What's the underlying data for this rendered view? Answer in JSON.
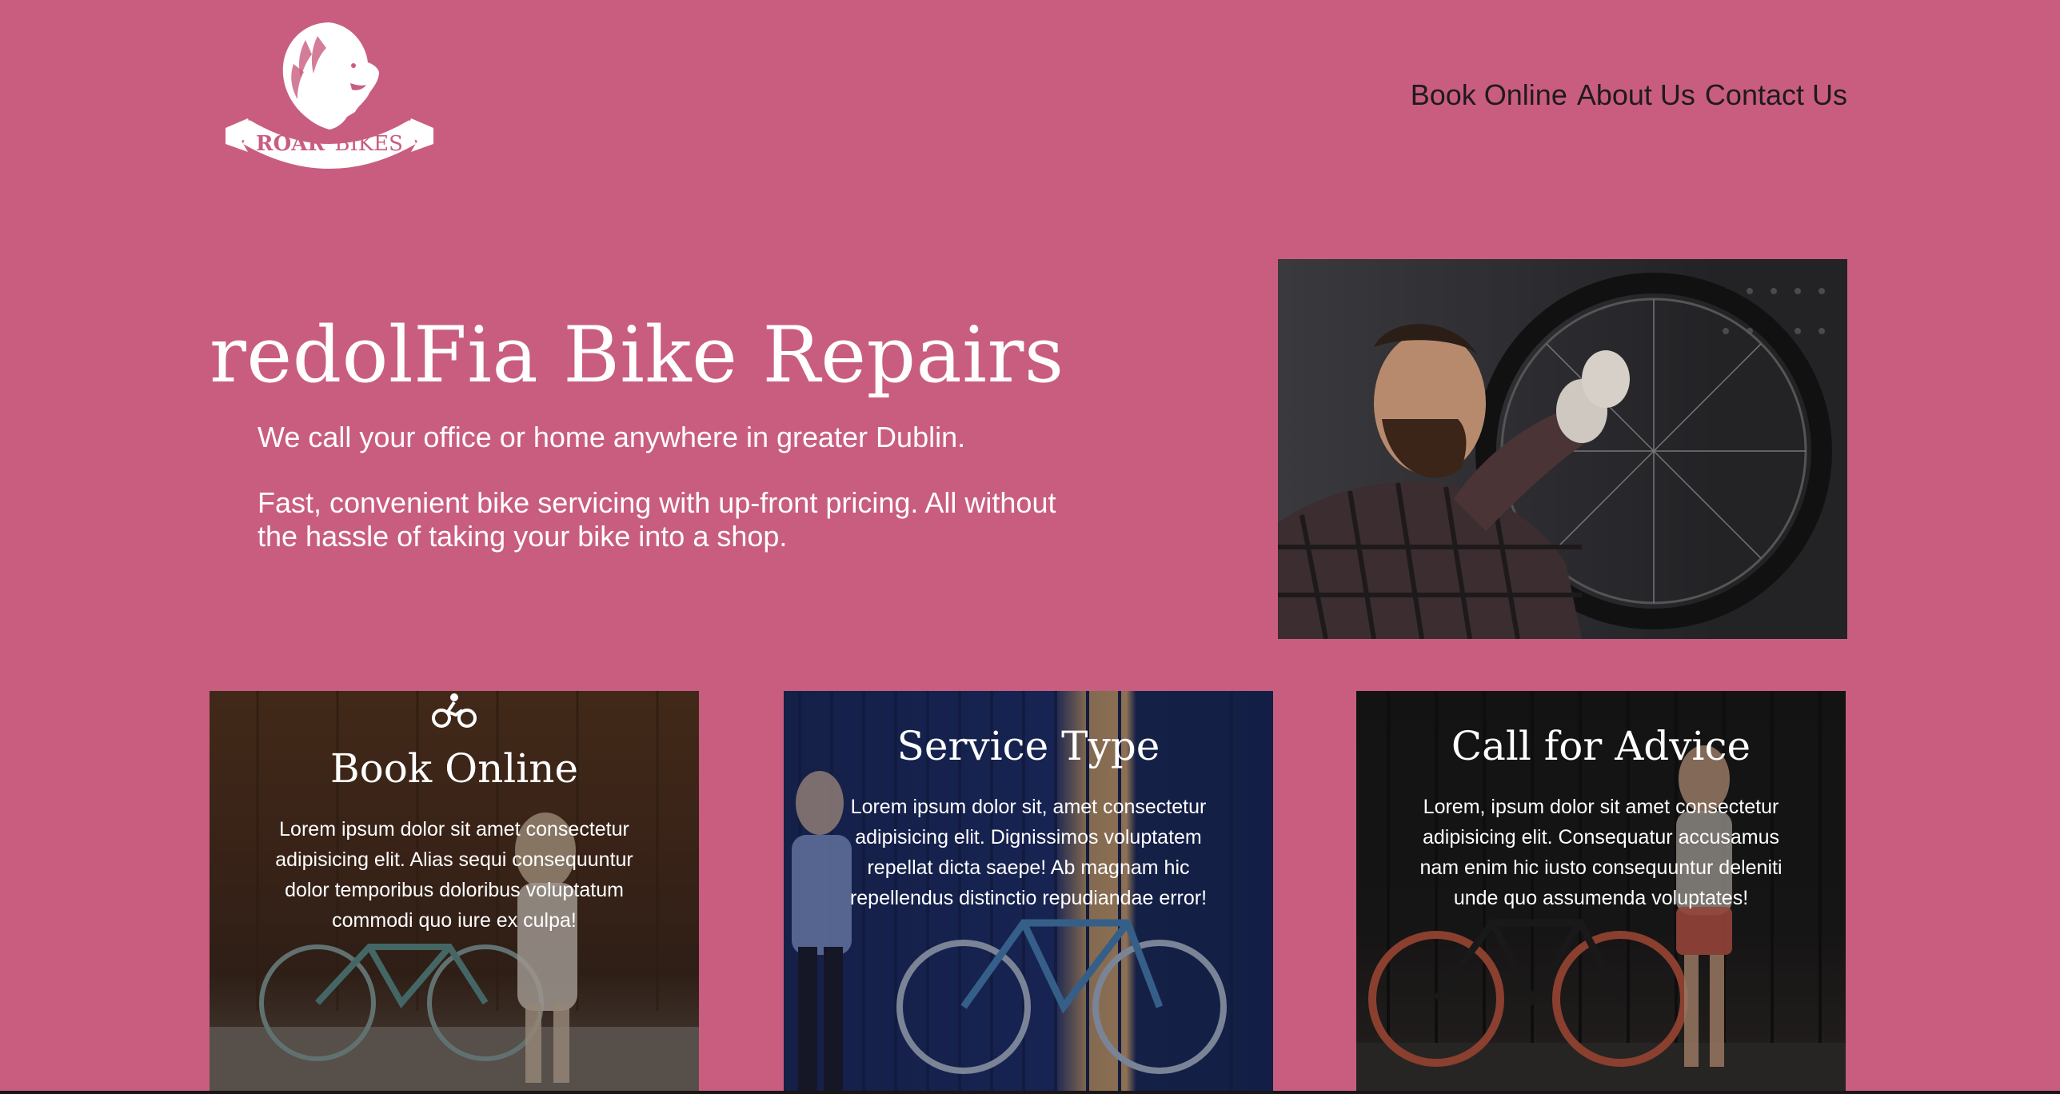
{
  "brand": {
    "logo_text_bold": "ROAR",
    "logo_text_light": "BIKES"
  },
  "nav": {
    "items": [
      {
        "label": "Book Online"
      },
      {
        "label": "About Us"
      },
      {
        "label": "Contact Us"
      }
    ]
  },
  "hero": {
    "title": "redolFia Bike Repairs",
    "paragraph_1": "We call your office or home anywhere in greater Dublin.",
    "paragraph_2": "Fast, convenient bike servicing with up-front pricing. All without the hassle of taking your bike into a shop."
  },
  "cards": [
    {
      "icon": "bicycle-rider-icon",
      "title": "Book Online",
      "text": "Lorem ipsum dolor sit amet consectetur adipisicing elit. Alias sequi consequuntur dolor temporibus doloribus voluptatum commodi quo iure ex culpa!"
    },
    {
      "title": "Service Type",
      "text": "Lorem ipsum dolor sit, amet consectetur adipisicing elit. Dignissimos voluptatem repellat dicta saepe! Ab magnam hic repellendus distinctio repudiandae error!"
    },
    {
      "title": "Call for Advice",
      "text": "Lorem, ipsum dolor sit amet consectetur adipisicing elit. Consequatur accusamus nam enim hic iusto consequuntur deleniti unde quo assumenda voluptates!"
    }
  ],
  "colors": {
    "background": "#c95d80",
    "nav_text": "#1f1a1e",
    "heading_text": "#ffffff"
  }
}
